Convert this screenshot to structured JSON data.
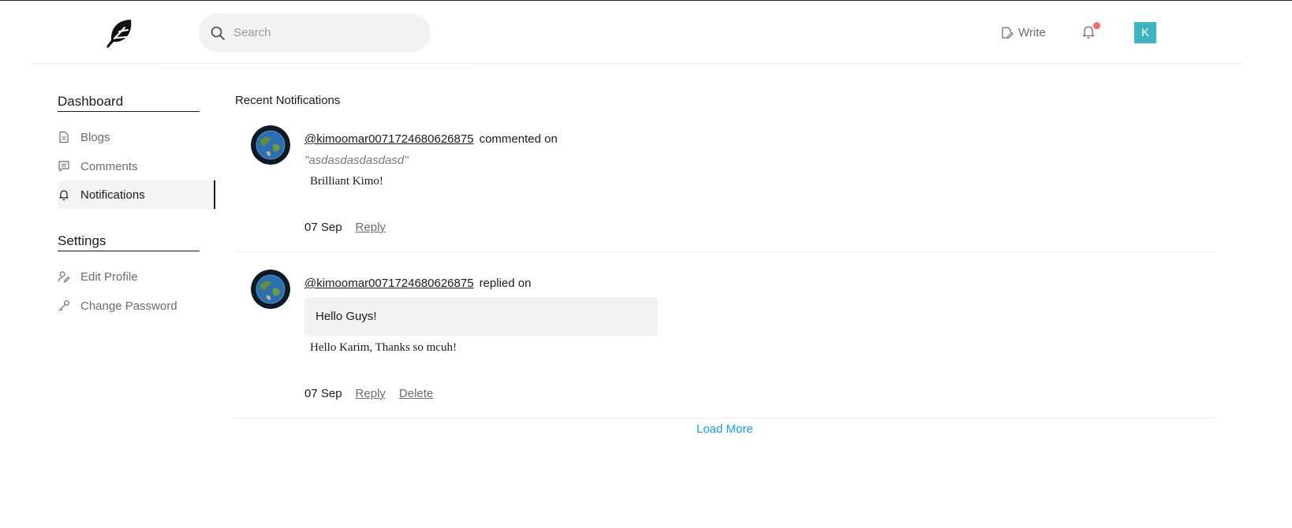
{
  "header": {
    "search_placeholder": "Search",
    "write_label": "Write",
    "avatar_letter": "K",
    "avatar_color": "#3fb3c2",
    "notification_dot_color": "#ff6b6b"
  },
  "sidebar": {
    "dashboard_title": "Dashboard",
    "dashboard_items": [
      {
        "label": "Blogs",
        "icon": "document-icon"
      },
      {
        "label": "Comments",
        "icon": "comment-icon"
      },
      {
        "label": "Notifications",
        "icon": "bell-icon",
        "active": true
      }
    ],
    "settings_title": "Settings",
    "settings_items": [
      {
        "label": "Edit Profile",
        "icon": "edit-user-icon"
      },
      {
        "label": "Change Password",
        "icon": "key-icon"
      }
    ]
  },
  "main": {
    "title": "Recent Notifications",
    "notifications": [
      {
        "user": "@kimoomar0071724680626875",
        "action": "commented on",
        "blog_title": "\"asdasdasdasdasd\"",
        "text": "Brilliant Kimo!",
        "date": "07 Sep",
        "reply_label": "Reply"
      },
      {
        "user": "@kimoomar0071724680626875",
        "action": "replied on",
        "replied_comment": "Hello Guys!",
        "text": "Hello Karim, Thanks so mcuh!",
        "date": "07 Sep",
        "reply_label": "Reply",
        "delete_label": "Delete"
      }
    ],
    "load_more_label": "Load More",
    "load_more_color": "#1a9be0"
  }
}
